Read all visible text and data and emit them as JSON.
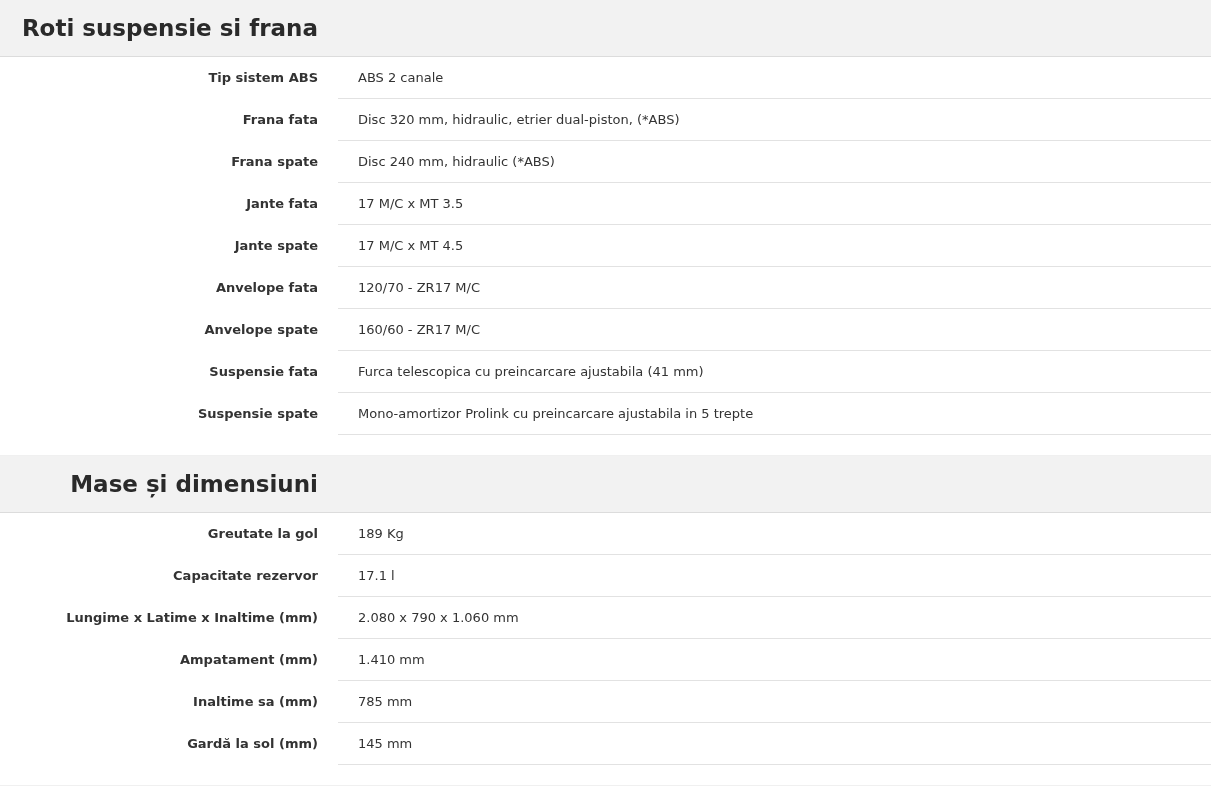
{
  "sections": [
    {
      "title": "Roti suspensie si frana",
      "rows": [
        {
          "label": "Tip sistem ABS",
          "value": "ABS 2 canale"
        },
        {
          "label": "Frana fata",
          "value": "Disc 320 mm, hidraulic, etrier dual-piston, (*ABS)"
        },
        {
          "label": "Frana spate",
          "value": "Disc 240 mm, hidraulic (*ABS)"
        },
        {
          "label": "Jante fata",
          "value": "17 M/C x MT 3.5"
        },
        {
          "label": "Jante spate",
          "value": "17 M/C x MT 4.5"
        },
        {
          "label": "Anvelope fata",
          "value": "120/70 - ZR17 M/C"
        },
        {
          "label": "Anvelope spate",
          "value": "160/60 - ZR17 M/C"
        },
        {
          "label": "Suspensie fata",
          "value": "Furca telescopica cu preincarcare ajustabila (41 mm)"
        },
        {
          "label": "Suspensie spate",
          "value": "Mono-amortizor Prolink cu preincarcare ajustabila in 5 trepte"
        }
      ]
    },
    {
      "title": "Mase și dimensiuni",
      "rows": [
        {
          "label": "Greutate la gol",
          "value": "189 Kg"
        },
        {
          "label": "Capacitate rezervor",
          "value": "17.1 l"
        },
        {
          "label": "Lungime x Latime x Inaltime (mm)",
          "value": "2.080 x 790 x 1.060 mm"
        },
        {
          "label": "Ampatament (mm)",
          "value": "1.410 mm"
        },
        {
          "label": "Inaltime sa (mm)",
          "value": "785 mm"
        },
        {
          "label": "Gardă la sol (mm)",
          "value": "145 mm"
        }
      ]
    }
  ]
}
